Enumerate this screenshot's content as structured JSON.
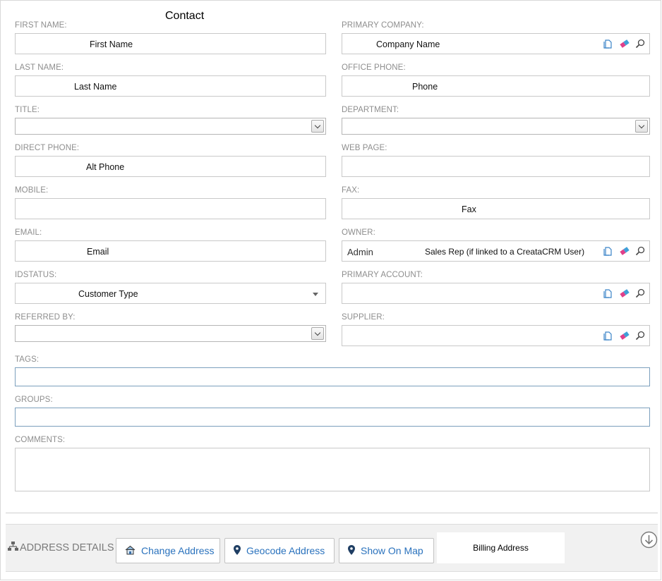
{
  "form": {
    "title": "Contact",
    "first_name": {
      "label": "FIRST NAME:",
      "value": "First Name"
    },
    "last_name": {
      "label": "LAST NAME:",
      "value": "Last Name"
    },
    "title_field": {
      "label": "TITLE:",
      "value": ""
    },
    "direct_phone": {
      "label": "DIRECT PHONE:",
      "value": "Alt Phone"
    },
    "mobile": {
      "label": "MOBILE:",
      "value": ""
    },
    "email": {
      "label": "EMAIL:",
      "value": "Email"
    },
    "idstatus": {
      "label": "IDSTATUS:",
      "value": "Customer Type"
    },
    "referred_by": {
      "label": "REFERRED BY:",
      "value": ""
    },
    "primary_company": {
      "label": "PRIMARY COMPANY:",
      "value": "Company Name"
    },
    "office_phone": {
      "label": "OFFICE PHONE:",
      "value": "Phone"
    },
    "department": {
      "label": "DEPARTMENT:",
      "value": ""
    },
    "web_page": {
      "label": "WEB PAGE:",
      "value": ""
    },
    "fax": {
      "label": "FAX:",
      "value": "Fax"
    },
    "owner": {
      "label": "OWNER:",
      "value": "Admin",
      "note": "Sales Rep (if linked to a CreataCRM User)"
    },
    "primary_account": {
      "label": "PRIMARY ACCOUNT:",
      "value": ""
    },
    "supplier": {
      "label": "SUPPLIER:",
      "value": ""
    },
    "tags": {
      "label": "TAGS:",
      "value": ""
    },
    "groups": {
      "label": "GROUPS:",
      "value": ""
    },
    "comments": {
      "label": "COMMENTS:",
      "value": ""
    }
  },
  "address": {
    "title": "ADDRESS DETAILS",
    "change_label": "Change Address",
    "geocode_label": "Geocode Address",
    "map_label": "Show On Map",
    "billing_label": "Billing Address"
  },
  "icons": {
    "copy": "copy-icon",
    "clear": "eraser-icon",
    "lookup": "search-icon",
    "pin": "map-pin-icon",
    "house": "house-icon",
    "sitemap": "sitemap-icon",
    "expand": "circle-arrow-down-icon"
  },
  "colors": {
    "link": "#2a72bd",
    "label": "#8e8e8e",
    "tag_border": "#7b9fbd",
    "eraser": "#e0408a"
  }
}
